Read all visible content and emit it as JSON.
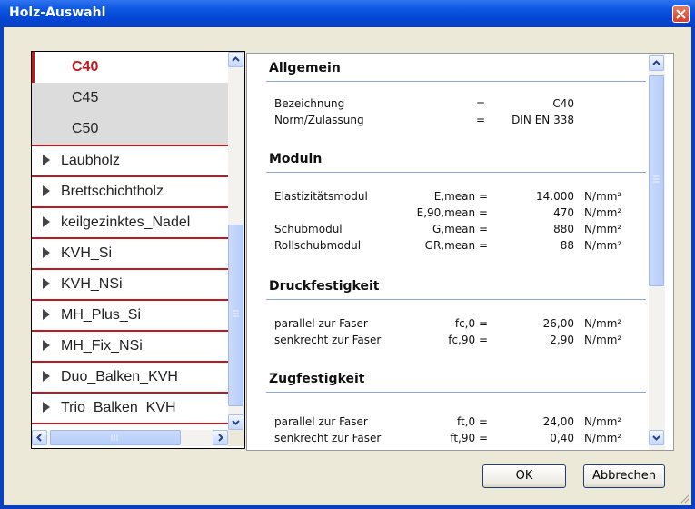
{
  "window": {
    "title": "Holz-Auswahl"
  },
  "left_list": {
    "sub_items": [
      "C40",
      "C45",
      "C50"
    ],
    "selected": "C40",
    "groups": [
      "Laubholz",
      "Brettschichtholz",
      "keilgezinktes_Nadel",
      "KVH_Si",
      "KVH_NSi",
      "MH_Plus_Si",
      "MH_Fix_NSi",
      "Duo_Balken_KVH",
      "Trio_Balken_KVH"
    ]
  },
  "details": {
    "allgemein": {
      "heading": "Allgemein",
      "rows": [
        {
          "label": "Bezeichnung",
          "eq": "=",
          "value": "C40"
        },
        {
          "label": "Norm/Zulassung",
          "eq": "=",
          "value": "DIN EN 338"
        }
      ]
    },
    "moduln": {
      "heading": "Moduln",
      "rows": [
        {
          "label": "Elastizitätsmodul",
          "symbol": "E,mean =",
          "value": "14.000",
          "unit": "N/mm²"
        },
        {
          "label": "",
          "symbol": "E,90,mean =",
          "value": "470",
          "unit": "N/mm²"
        },
        {
          "label": "Schubmodul",
          "symbol": "G,mean =",
          "value": "880",
          "unit": "N/mm²"
        },
        {
          "label": "Rollschubmodul",
          "symbol": "GR,mean =",
          "value": "88",
          "unit": "N/mm²"
        }
      ]
    },
    "druck": {
      "heading": "Druckfestigkeit",
      "rows": [
        {
          "label": "parallel zur Faser",
          "symbol": "fc,0 =",
          "value": "26,00",
          "unit": "N/mm²"
        },
        {
          "label": "senkrecht zur Faser",
          "symbol": "fc,90 =",
          "value": "2,90",
          "unit": "N/mm²"
        }
      ]
    },
    "zug": {
      "heading": "Zugfestigkeit",
      "rows": [
        {
          "label": "parallel zur Faser",
          "symbol": "ft,0 =",
          "value": "24,00",
          "unit": "N/mm²"
        },
        {
          "label": "senkrecht zur Faser",
          "symbol": "ft,90 =",
          "value": "0,40",
          "unit": "N/mm²"
        }
      ]
    }
  },
  "buttons": {
    "ok": "OK",
    "cancel": "Abbrechen"
  },
  "colors": {
    "titlebar": "#0a56e0",
    "selection_accent": "#c0181e",
    "dialog_bg": "#ece9d8"
  }
}
